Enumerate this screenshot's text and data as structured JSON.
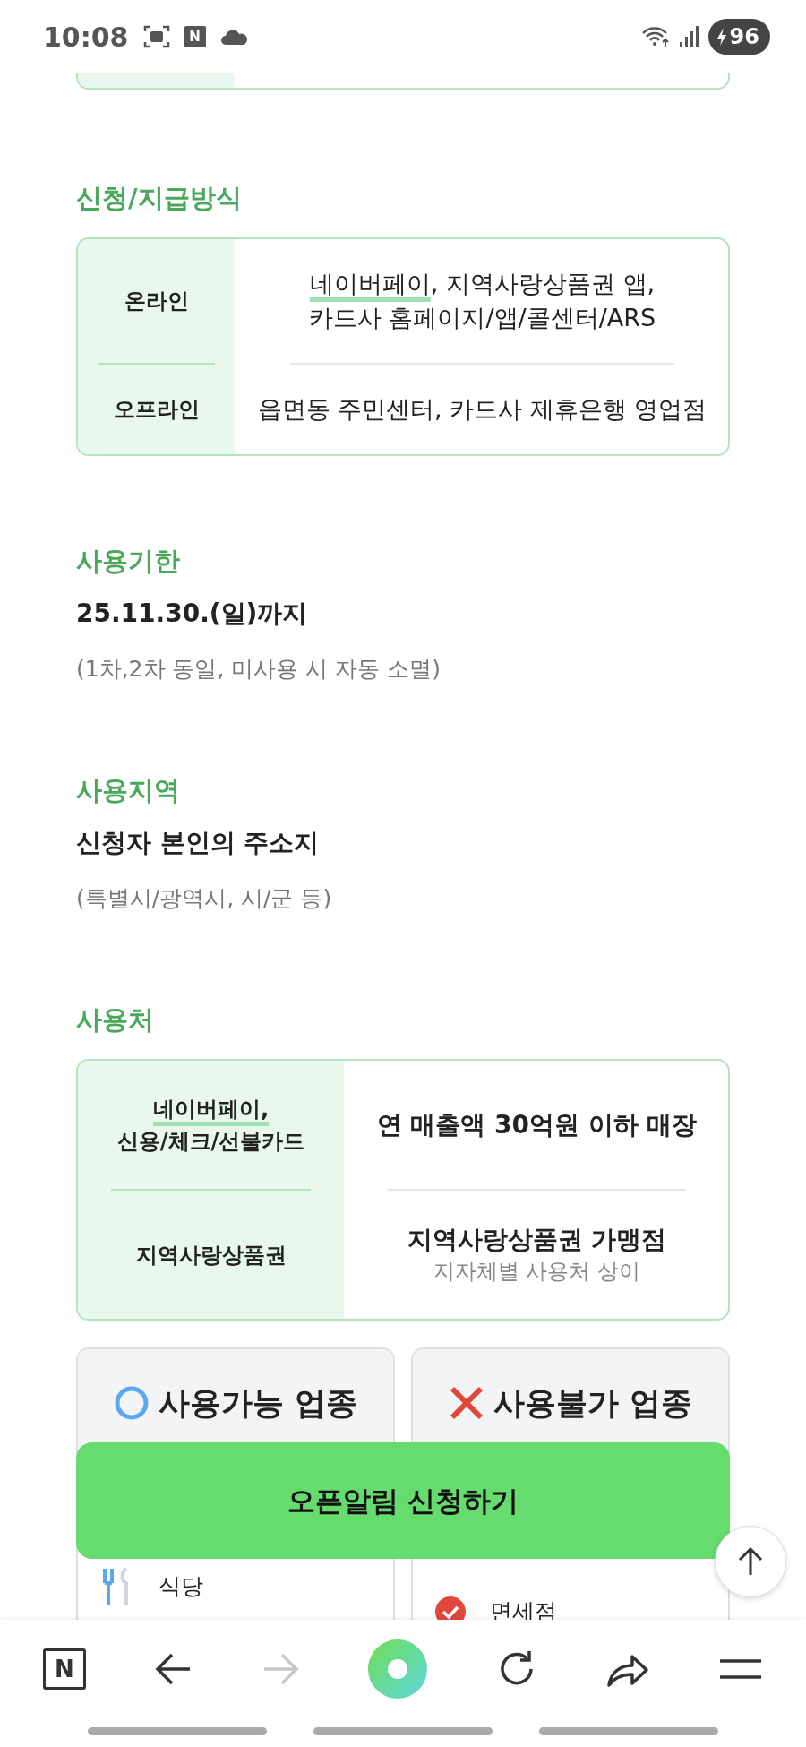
{
  "status_bar": {
    "time": "10:08",
    "app_letter": "N",
    "battery": "96",
    "charging": true
  },
  "sections": [
    {
      "kind": "table",
      "title": "신청/지급방식",
      "rows": [
        {
          "label": "온라인",
          "value_highlight": "네이버페이",
          "value_lines": [
            ", 지역사랑상품권 앱,",
            "카드사 홈페이지/앱/콜센터/ARS"
          ]
        },
        {
          "label": "오프라인",
          "value_lines": [
            "읍면동 주민센터, 카드사 제휴은행 영업점"
          ]
        }
      ]
    },
    {
      "kind": "info",
      "title": "사용기한",
      "value": "25.11.30.(일)까지",
      "note": "(1차,2차 동일, 미사용 시 자동 소멸)"
    },
    {
      "kind": "info",
      "title": "사용지역",
      "value": "신청자 본인의 주소지",
      "note": "(특별시/광역시, 시/군 등)"
    },
    {
      "kind": "usage",
      "title": "사용처",
      "rows": [
        {
          "label_highlight": "네이버페이,",
          "label": "신용/체크/선불카드",
          "value": "연 매출액 30억원 이하 매장"
        },
        {
          "label": "지역사랑상품권",
          "value": "지역사랑상품권 가맹점",
          "sub": "지자체별 사용처 상이"
        }
      ]
    }
  ],
  "categories": [
    {
      "kind": "allowed",
      "title": "사용가능 업종",
      "items": [
        {
          "label": "식당"
        }
      ]
    },
    {
      "kind": "blocked",
      "title": "사용불가 업종",
      "items": [
        {
          "label": "면세점"
        }
      ]
    }
  ],
  "cta_button": "오픈알림 신청하기",
  "bottom_nav": [
    {
      "kind": "logo",
      "text": "N",
      "disabled": false
    },
    {
      "kind": "back",
      "disabled": false
    },
    {
      "kind": "forward",
      "disabled": true
    },
    {
      "kind": "home",
      "disabled": false
    },
    {
      "kind": "reload",
      "disabled": false
    },
    {
      "kind": "share",
      "disabled": false
    },
    {
      "kind": "menu",
      "disabled": false
    }
  ]
}
